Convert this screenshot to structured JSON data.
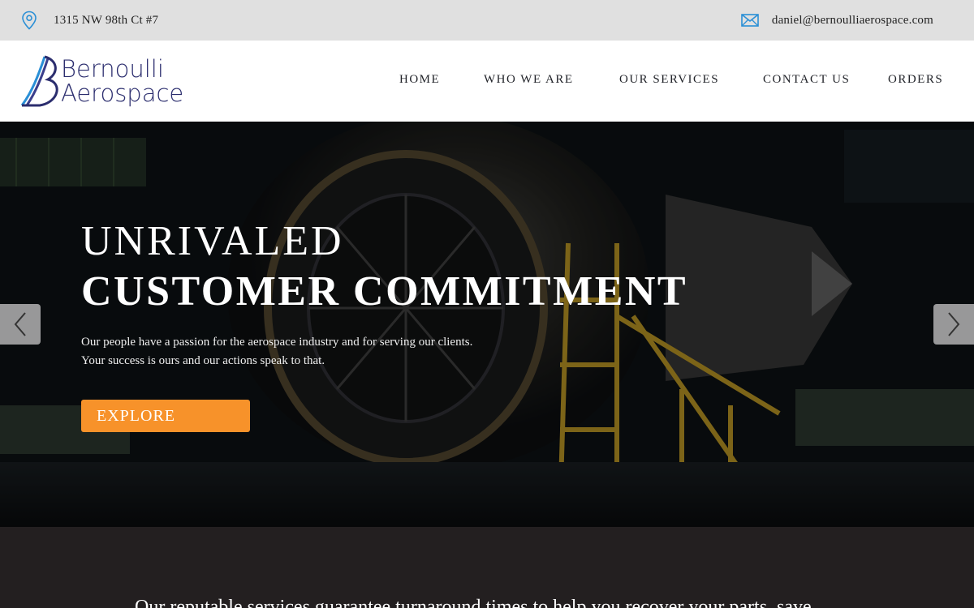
{
  "topbar": {
    "address": "1315 NW 98th Ct #7",
    "email": "daniel@bernoulliaerospace.com"
  },
  "header": {
    "logo_line1": "Bernoulli",
    "logo_line2": "Aerospace",
    "nav": [
      "HOME",
      "WHO WE ARE",
      "OUR SERVICES",
      "CONTACT US",
      "ORDERS"
    ]
  },
  "hero": {
    "title_line1": "UNRIVALED",
    "title_line2": "CUSTOMER COMMITMENT",
    "text_line1": "Our people have a passion for the aerospace industry and for serving our clients.",
    "text_line2": "Your success is ours and our actions speak to that.",
    "cta": "EXPLORE"
  },
  "band": {
    "text": "Our reputable services guarantee turnaround times to help you recover your parts, save"
  },
  "colors": {
    "accent": "#f7922a",
    "brand": "#2b2d6e",
    "icon_blue": "#2a8fd6"
  },
  "icons": [
    "location-pin-icon",
    "envelope-icon",
    "chevron-left-icon",
    "chevron-right-icon"
  ]
}
